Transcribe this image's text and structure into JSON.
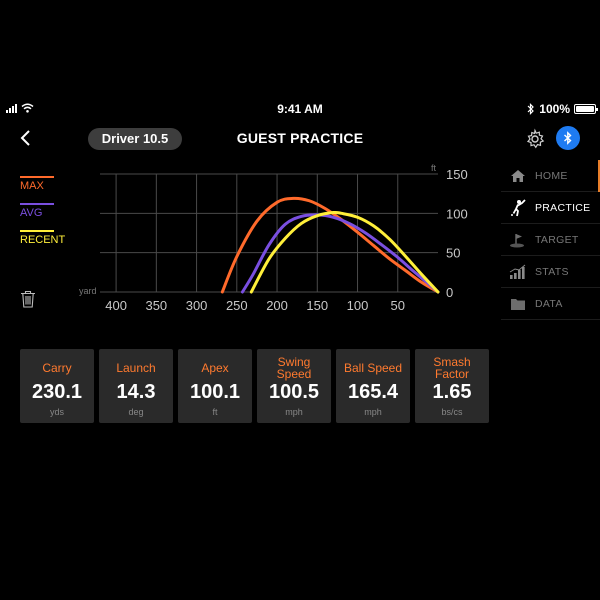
{
  "status_bar": {
    "time": "9:41 AM",
    "battery": "100%"
  },
  "header": {
    "club": "Driver 10.5",
    "title": "GUEST PRACTICE"
  },
  "legend": [
    {
      "label": "MAX",
      "color": "#ff6a2b"
    },
    {
      "label": "AVG",
      "color": "#7a4fe0"
    },
    {
      "label": "RECENT",
      "color": "#ffef3a"
    }
  ],
  "sidebar": {
    "items": [
      {
        "label": "HOME",
        "icon": "home-icon",
        "active": false
      },
      {
        "label": "PRACTICE",
        "icon": "golfer-icon",
        "active": true
      },
      {
        "label": "TARGET",
        "icon": "flag-icon",
        "active": false
      },
      {
        "label": "STATS",
        "icon": "bar-stats-icon",
        "active": false
      },
      {
        "label": "DATA",
        "icon": "folder-icon",
        "active": false
      }
    ]
  },
  "stats": [
    {
      "title": "Carry",
      "value": "230.1",
      "unit": "yds"
    },
    {
      "title": "Launch",
      "value": "14.3",
      "unit": "deg"
    },
    {
      "title": "Apex",
      "value": "100.1",
      "unit": "ft"
    },
    {
      "title": "Swing Speed",
      "value": "100.5",
      "unit": "mph"
    },
    {
      "title": "Ball Speed",
      "value": "165.4",
      "unit": "mph"
    },
    {
      "title": "Smash Factor",
      "value": "1.65",
      "unit": "bs/cs"
    }
  ],
  "chart_data": {
    "type": "line",
    "xlabel": "yard",
    "ylabel": "ft",
    "x_ticks": [
      "400",
      "350",
      "300",
      "250",
      "200",
      "150",
      "100",
      "50"
    ],
    "y_ticks": [
      "0",
      "50",
      "100",
      "150"
    ],
    "xlim": [
      420,
      0
    ],
    "ylim": [
      0,
      150
    ],
    "grid": true,
    "legend_placement": "left",
    "series": [
      {
        "name": "MAX",
        "color": "#ff6a2b",
        "x": [
          268,
          250,
          225,
          200,
          180,
          160,
          140,
          120,
          100,
          80,
          60,
          40,
          20,
          0
        ],
        "y": [
          0,
          45,
          90,
          114,
          119,
          116,
          106,
          92,
          76,
          59,
          42,
          27,
          12,
          0
        ]
      },
      {
        "name": "AVG",
        "color": "#7a4fe0",
        "x": [
          243,
          230,
          210,
          190,
          170,
          150,
          130,
          110,
          90,
          70,
          50,
          30,
          10,
          0
        ],
        "y": [
          0,
          22,
          60,
          86,
          96,
          98,
          95,
          87,
          75,
          60,
          44,
          26,
          9,
          0
        ]
      },
      {
        "name": "RECENT",
        "color": "#ffef3a",
        "x": [
          232,
          210,
          190,
          170,
          150,
          130,
          120,
          100,
          80,
          60,
          40,
          20,
          0
        ],
        "y": [
          0,
          42,
          68,
          87,
          97,
          101,
          100,
          95,
          84,
          67,
          45,
          22,
          0
        ]
      }
    ]
  }
}
